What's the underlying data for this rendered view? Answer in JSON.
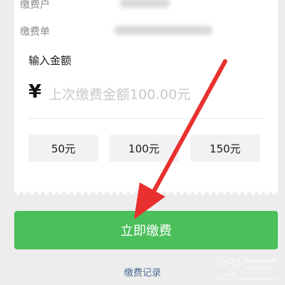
{
  "info": {
    "payer_label": "缴费户",
    "bill_label": "缴费单"
  },
  "amount": {
    "section_title": "输入金额",
    "currency_symbol": "¥",
    "placeholder": "上次缴费金额100.00元"
  },
  "quick_amounts": [
    "50元",
    "100元",
    "150元"
  ],
  "actions": {
    "pay_label": "立即缴费",
    "history_label": "缴费记录"
  },
  "annotation": {
    "arrow_color": "#e8312f",
    "arrow_icon": "red-arrow-annotation"
  },
  "colors": {
    "primary_green": "#4bbf5a",
    "link_blue": "#4a6a94"
  }
}
